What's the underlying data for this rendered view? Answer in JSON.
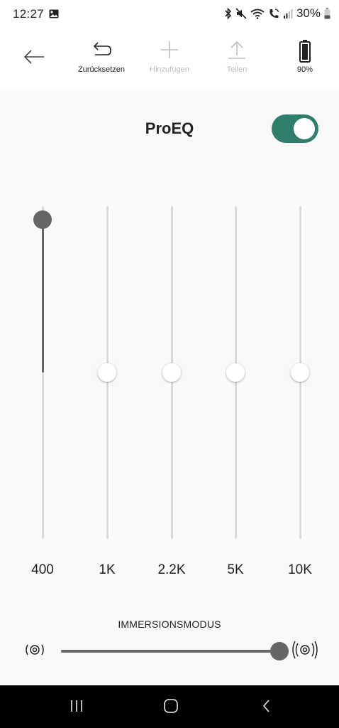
{
  "status_bar": {
    "time": "12:27",
    "battery_percent": "30%",
    "icons": [
      "gallery-icon",
      "bluetooth-icon",
      "mute-icon",
      "wifi-icon",
      "volte-call-icon",
      "signal-icon",
      "battery-icon"
    ]
  },
  "toolbar": {
    "back_icon": "arrow-left-icon",
    "reset_label": "Zurücksetzen",
    "add_label": "Hinzufügen",
    "share_label": "Teilen",
    "battery_label": "90%"
  },
  "main": {
    "title": "ProEQ",
    "toggle_on": true,
    "accent_color": "#2f7d6d",
    "bands": [
      {
        "label": "400",
        "level": 0.96
      },
      {
        "label": "1K",
        "level": 0.5
      },
      {
        "label": "2.2K",
        "level": 0.5
      },
      {
        "label": "5K",
        "level": 0.5
      },
      {
        "label": "10K",
        "level": 0.5
      }
    ],
    "immersion": {
      "title": "IMMERSIONSMODUS",
      "level": 1.0,
      "left_icon": "sound-low-icon",
      "right_icon": "sound-high-icon"
    }
  },
  "nav_bar": {
    "icons": [
      "recents-icon",
      "home-icon",
      "back-icon"
    ]
  }
}
